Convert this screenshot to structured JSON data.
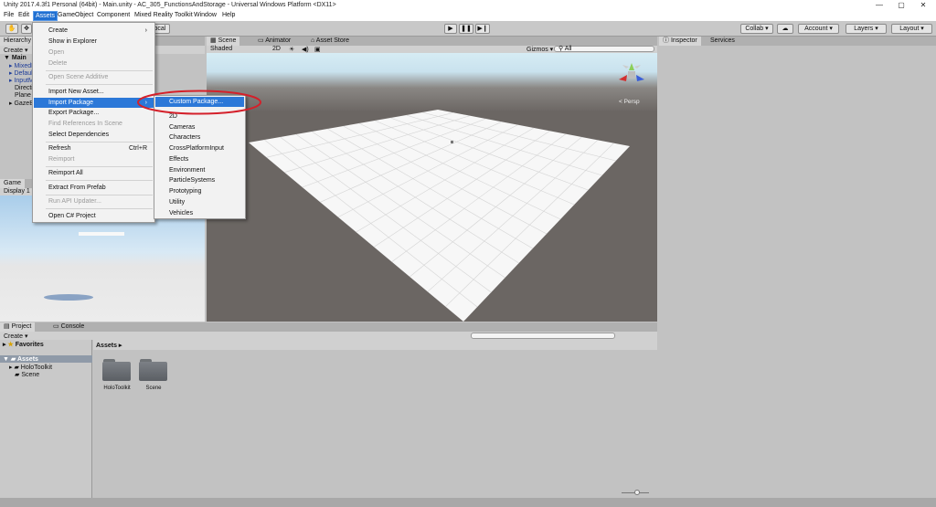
{
  "window": {
    "title": "Unity 2017.4.3f1 Personal (64bit) - Main.unity - AC_305_FunctionsAndStorage - Universal Windows Platform <DX11>",
    "controls": [
      "—",
      "▢",
      "✕"
    ]
  },
  "menubar": [
    "File",
    "Edit",
    "Assets",
    "GameObject",
    "Component",
    "Mixed Reality Toolkit",
    "Window",
    "Help"
  ],
  "toolbar": {
    "local_label": "Local",
    "play_buttons": [
      "▶",
      "❚❚",
      "▶❙"
    ],
    "collab": "Collab ▾",
    "account": "Account",
    "layers": "Layers",
    "layout": "Layout"
  },
  "hierarchy": {
    "tab": "Hierarchy",
    "create": "Create ▾",
    "items": [
      "Main",
      "MixedRealityCameraParent",
      "DefaultCursor",
      "InputManager",
      "Directional Light",
      "Plane",
      "GazeBeam"
    ]
  },
  "game": {
    "tab": "Game",
    "display": "Display 1"
  },
  "scene": {
    "tabs": [
      "Scene",
      "Animator",
      "Asset Store"
    ],
    "shaded": "Shaded",
    "mode_2d": "2D",
    "gizmos": "Gizmos ▾",
    "search_placeholder": "All",
    "persp": "< Persp"
  },
  "inspector": {
    "tabs": [
      "Inspector",
      "Services"
    ]
  },
  "project": {
    "tabs": [
      "Project",
      "Console"
    ],
    "create": "Create ▾",
    "favorites": "Favorites",
    "assets_root": "Assets",
    "tree": [
      "HoloToolkit",
      "Scene"
    ],
    "breadcrumb": "Assets ▸",
    "folders": [
      "HoloToolkit",
      "Scene"
    ]
  },
  "assets_menu": {
    "items": [
      {
        "label": "Create",
        "state": "normal",
        "arrow": "›"
      },
      {
        "label": "Show in Explorer",
        "state": "normal"
      },
      {
        "label": "Open",
        "state": "disabled"
      },
      {
        "label": "Delete",
        "state": "disabled"
      },
      {
        "label": "Open Scene Additive",
        "state": "disabled"
      },
      {
        "label": "Import New Asset...",
        "state": "normal"
      },
      {
        "label": "Import Package",
        "state": "highlighted",
        "arrow": "›"
      },
      {
        "label": "Export Package...",
        "state": "normal"
      },
      {
        "label": "Find References In Scene",
        "state": "disabled"
      },
      {
        "label": "Select Dependencies",
        "state": "normal"
      },
      {
        "label": "Refresh",
        "state": "normal",
        "shortcut": "Ctrl+R"
      },
      {
        "label": "Reimport",
        "state": "disabled"
      },
      {
        "label": "Reimport All",
        "state": "normal"
      },
      {
        "label": "Extract From Prefab",
        "state": "normal"
      },
      {
        "label": "Run API Updater...",
        "state": "disabled"
      },
      {
        "label": "Open C# Project",
        "state": "normal"
      }
    ]
  },
  "import_package_submenu": {
    "items": [
      "Custom Package...",
      "2D",
      "Cameras",
      "Characters",
      "CrossPlatformInput",
      "Effects",
      "Environment",
      "ParticleSystems",
      "Prototyping",
      "Utility",
      "Vehicles"
    ]
  },
  "colors": {
    "menu_highlight": "#2c78d8",
    "annotation_red": "#d4202a",
    "scene_bg": "#6b6663"
  }
}
